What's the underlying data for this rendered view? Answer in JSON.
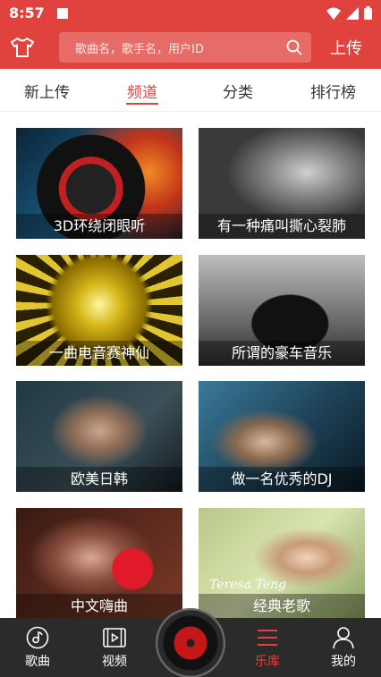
{
  "status_bar": {
    "time": "8:57"
  },
  "header": {
    "search_placeholder": "歌曲名，歌手名，用户ID",
    "upload_label": "上传"
  },
  "tabs": [
    {
      "label": "新上传"
    },
    {
      "label": "频道",
      "active": true
    },
    {
      "label": "分类"
    },
    {
      "label": "排行榜"
    }
  ],
  "channels": [
    {
      "title": "3D环绕闭眼听"
    },
    {
      "title": "有一种痛叫撕心裂肺"
    },
    {
      "title": "一曲电音赛神仙"
    },
    {
      "title": "所谓的豪车音乐"
    },
    {
      "title": "欧美日韩"
    },
    {
      "title": "做一名优秀的DJ"
    },
    {
      "title": "中文嗨曲"
    },
    {
      "title": "经典老歌",
      "image_text": "Teresa Teng"
    }
  ],
  "bottom_nav": [
    {
      "label": "歌曲",
      "icon": "music-note-icon"
    },
    {
      "label": "视频",
      "icon": "video-icon"
    },
    {
      "label": "",
      "icon": "vinyl-disc-icon"
    },
    {
      "label": "乐库",
      "icon": "menu-icon",
      "active": true
    },
    {
      "label": "我的",
      "icon": "user-icon"
    }
  ],
  "colors": {
    "accent": "#e0433e",
    "nav_bg": "#2b2b2b"
  }
}
